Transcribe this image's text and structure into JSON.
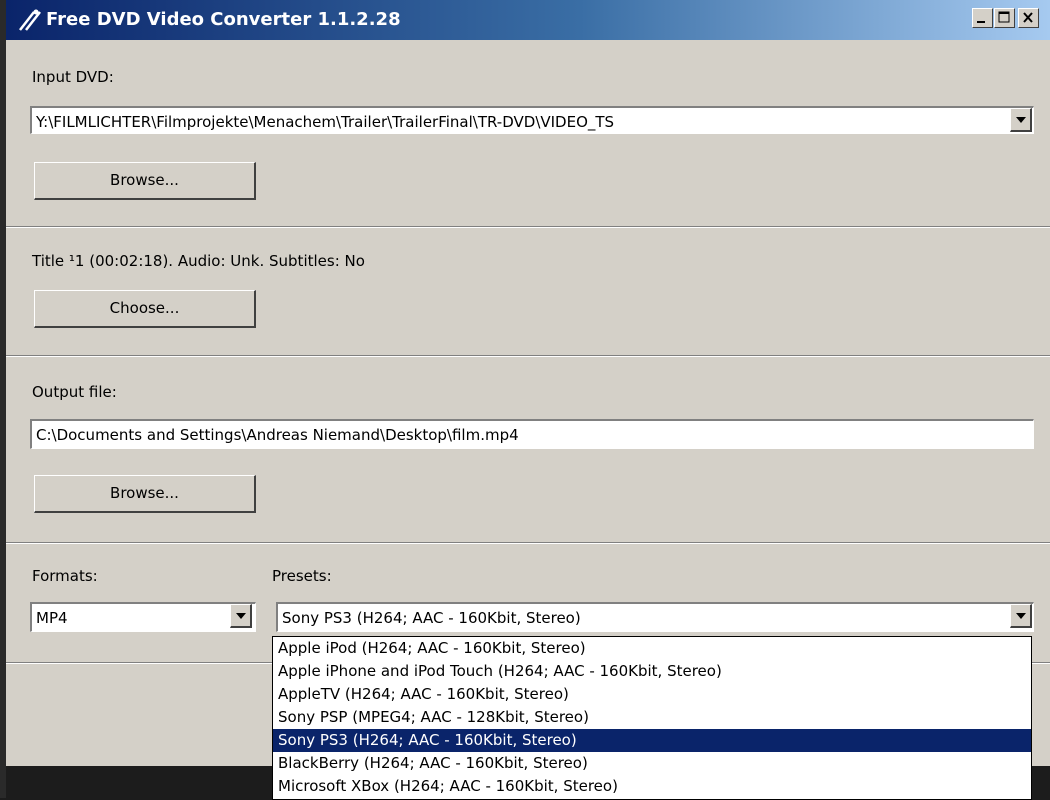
{
  "window": {
    "title": "Free DVD Video Converter 1.1.2.28",
    "controls": [
      "minimize-icon",
      "maximize-icon",
      "close-icon"
    ]
  },
  "input_dvd": {
    "label": "Input DVD:",
    "value": "Y:\\FILMLICHTER\\Filmprojekte\\Menachem\\Trailer\\TrailerFinal\\TR-DVD\\VIDEO_TS",
    "browse_label": "Browse..."
  },
  "title_info": {
    "text": "Title ¹1 (00:02:18).  Audio: Unk.  Subtitles: No",
    "choose_label": "Choose..."
  },
  "output": {
    "label": "Output file:",
    "value": "C:\\Documents and Settings\\Andreas Niemand\\Desktop\\film.mp4",
    "browse_label": "Browse..."
  },
  "formats": {
    "label": "Formats:",
    "value": "MP4"
  },
  "presets": {
    "label": "Presets:",
    "value": "Sony PS3 (H264; AAC - 160Kbit, Stereo)",
    "options": [
      "Apple iPod (H264; AAC - 160Kbit, Stereo)",
      "Apple iPhone and iPod Touch (H264; AAC - 160Kbit, Stereo)",
      "AppleTV (H264; AAC - 160Kbit, Stereo)",
      "Sony PSP (MPEG4; AAC - 128Kbit, Stereo)",
      "Sony PS3 (H264; AAC - 160Kbit, Stereo)",
      "BlackBerry (H264; AAC - 160Kbit, Stereo)",
      "Microsoft XBox (H264; AAC - 160Kbit, Stereo)"
    ],
    "selected_index": 4
  },
  "colors": {
    "titlebar_start": "#0a246a",
    "titlebar_end": "#a6caf0",
    "face": "#d4d0c8",
    "selection": "#0a246a"
  }
}
